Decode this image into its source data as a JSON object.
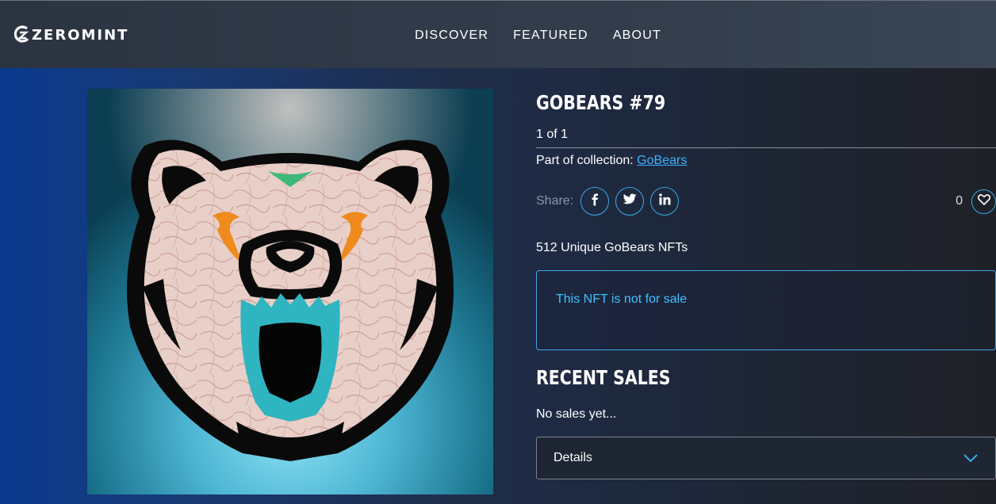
{
  "brand": {
    "name": "ZEROMINT",
    "logo_icon": "zeromint-logo-icon"
  },
  "nav": {
    "items": [
      "DISCOVER",
      "FEATURED",
      "ABOUT"
    ]
  },
  "nft": {
    "title": "GOBEARS #79",
    "edition": "1 of 1",
    "collection_prefix": "Part of collection: ",
    "collection_name": "GoBears",
    "image_icon": "bear-head-artwork"
  },
  "share": {
    "label": "Share:",
    "icons": [
      "facebook-icon",
      "twitter-icon",
      "linkedin-icon"
    ]
  },
  "likes": {
    "count": "0",
    "icon": "heart-icon"
  },
  "description": "512 Unique GoBears NFTs",
  "sale_status": "This NFT is not for sale",
  "recent_sales": {
    "heading": "RECENT SALES",
    "empty_text": "No sales yet..."
  },
  "details": {
    "label": "Details",
    "icon": "chevron-down-icon"
  },
  "colors": {
    "accent": "#3aa8e8",
    "link": "#3fb0ff",
    "sale_text": "#3fc1ff",
    "header_bg": "#323c4b"
  }
}
